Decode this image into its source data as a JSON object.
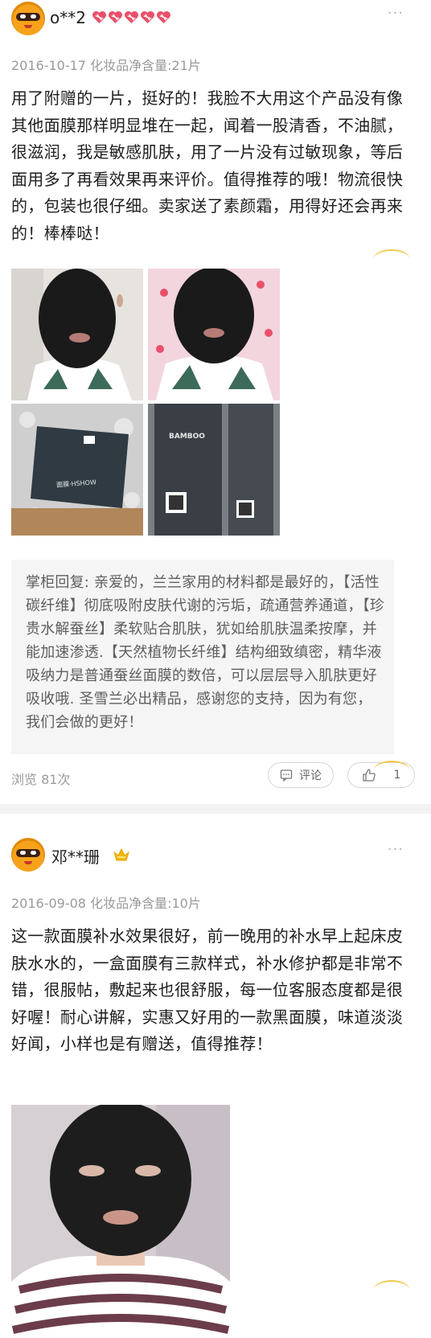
{
  "reviews": [
    {
      "username": "o**2",
      "date_meta": "2016-10-17 化妆品净含量:21片",
      "text": "用了附赠的一片，挺好的！我脸不大用这个产品没有像其他面膜那样明显堆在一起，闻着一股清香，不油腻，很滋润，我是敏感肌肤，用了一片没有过敏现象，等后面用多了再看效果再来评价。值得推荐的哦！物流很快的，包装也很仔细。卖家送了素颜霜，用得好还会再来的！棒棒哒！",
      "reply": "掌柜回复: 亲爱的，兰兰家用的材料都是最好的，【活性碳纤维】彻底吸附皮肤代谢的污垢，疏通营养通道，【珍贵水解蚕丝】柔软贴合肌肤，犹如给肌肤温柔按摩，并能加速渗透.【天然植物长纤维】结构细致缜密，精华液吸纳力是普通蚕丝面膜的数倍，可以层层导入肌肤更好吸收哦. 圣雪兰必出精品，感谢您的支持，因为有您，我们会做的更好！",
      "views": "浏览 81次",
      "comment_label": "评论",
      "like_count": "1",
      "box_text_1": "面膜·HSHOW",
      "box_text_2": "BAMBOO"
    },
    {
      "username": "邓**珊",
      "date_meta": "2016-09-08 化妆品净含量:10片",
      "text": "这一款面膜补水效果很好，前一晚用的补水早上起床皮肤水水的，一盒面膜有三款样式，补水修护都是非常不错，很服帖，敷起来也很舒服，每一位客服态度都是很好喔！耐心讲解，实惠又好用的一款黑面膜，味道淡淡好闻，小样也是有赠送，值得推荐！"
    }
  ],
  "colors": {
    "heart": "#e8506a",
    "crown": "#f5b800",
    "accent": "#f2c94c"
  }
}
